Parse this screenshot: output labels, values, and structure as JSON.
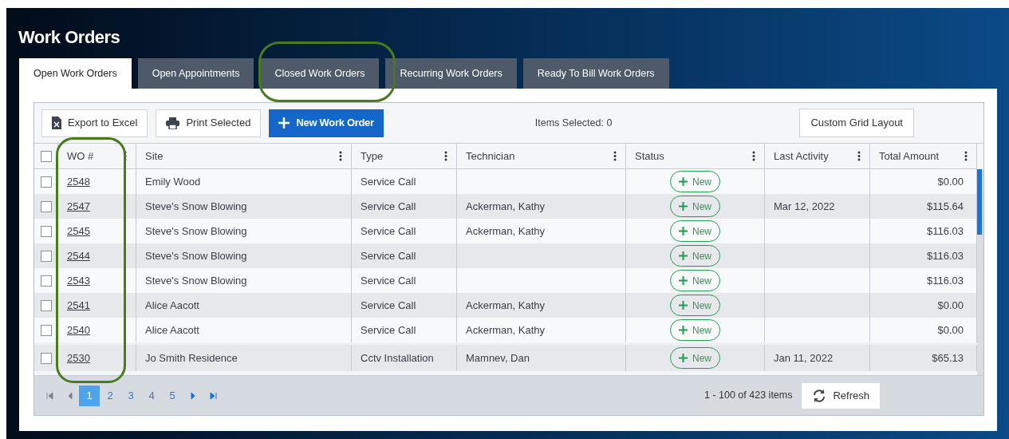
{
  "title": "Work Orders",
  "tabs": [
    {
      "label": "Open Work Orders",
      "selected": true
    },
    {
      "label": "Open Appointments",
      "selected": false
    },
    {
      "label": "Closed Work Orders",
      "selected": false
    },
    {
      "label": "Recurring Work Orders",
      "selected": false
    },
    {
      "label": "Ready To Bill Work Orders",
      "selected": false
    }
  ],
  "toolbar": {
    "export": "Export to Excel",
    "print": "Print Selected",
    "new": "New Work Order",
    "items_selected": "Items Selected: 0",
    "custom_layout": "Custom Grid Layout"
  },
  "table": {
    "select_all": {
      "checked": false
    },
    "columns": [
      {
        "label": "WO #"
      },
      {
        "label": "Site"
      },
      {
        "label": "Type"
      },
      {
        "label": "Technician"
      },
      {
        "label": "Status"
      },
      {
        "label": "Last Activity"
      },
      {
        "label": "Total Amount"
      }
    ],
    "rows": [
      {
        "checked": false,
        "wo": "2548",
        "site": "Emily Wood",
        "type": "Service Call",
        "technician": "",
        "status": "New",
        "last_activity": "",
        "total": "$0.00"
      },
      {
        "checked": false,
        "wo": "2547",
        "site": "Steve's Snow Blowing",
        "type": "Service Call",
        "technician": "Ackerman, Kathy",
        "status": "New",
        "last_activity": "Mar 12, 2022",
        "total": "$115.64"
      },
      {
        "checked": false,
        "wo": "2545",
        "site": "Steve's Snow Blowing",
        "type": "Service Call",
        "technician": "Ackerman, Kathy",
        "status": "New",
        "last_activity": "",
        "total": "$116.03"
      },
      {
        "checked": false,
        "wo": "2544",
        "site": "Steve's Snow Blowing",
        "type": "Service Call",
        "technician": "",
        "status": "New",
        "last_activity": "",
        "total": "$116.03"
      },
      {
        "checked": false,
        "wo": "2543",
        "site": "Steve's Snow Blowing",
        "type": "Service Call",
        "technician": "",
        "status": "New",
        "last_activity": "",
        "total": "$116.03"
      },
      {
        "checked": false,
        "wo": "2541",
        "site": "Alice Aacott",
        "type": "Service Call",
        "technician": "Ackerman, Kathy",
        "status": "New",
        "last_activity": "",
        "total": "$0.00"
      },
      {
        "checked": false,
        "wo": "2540",
        "site": "Alice Aacott",
        "type": "Service Call",
        "technician": "Ackerman, Kathy",
        "status": "New",
        "last_activity": "",
        "total": "$0.00"
      },
      {
        "checked": false,
        "wo": "2530",
        "site": "Jo Smith Residence",
        "type": "Cctv Installation",
        "technician": "Mamnev, Dan",
        "status": "New",
        "last_activity": "Jan 11, 2022",
        "total": "$65.13"
      }
    ]
  },
  "pager": {
    "pages": [
      {
        "label": "1",
        "selected": true
      },
      {
        "label": "2",
        "selected": false
      },
      {
        "label": "3",
        "selected": false
      },
      {
        "label": "4",
        "selected": false
      },
      {
        "label": "5",
        "selected": false
      }
    ],
    "summary": "1 - 100 of 423 items",
    "refresh": "Refresh"
  }
}
